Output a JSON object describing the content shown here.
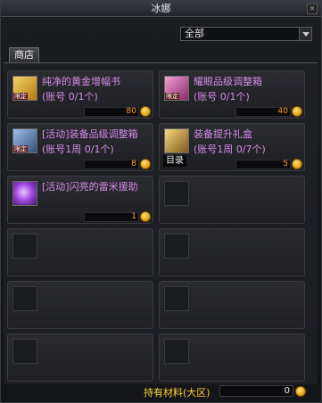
{
  "window": {
    "title": "冰娜"
  },
  "filter": {
    "selected": "全部"
  },
  "tab": {
    "label": "商店"
  },
  "catalog_label": "目录",
  "footer": {
    "label": "持有材料(大区)",
    "value": "0"
  },
  "items": [
    {
      "name": "纯净的黄金增幅书",
      "limit": "(账号 0/1个)",
      "price": "80",
      "badge": "限定",
      "icon": "gold-book-icon",
      "color": "#d9a22a"
    },
    {
      "name": "耀眼品级调整箱",
      "limit": "(账号 0/1个)",
      "price": "40",
      "badge": "限定",
      "icon": "pink-box-icon",
      "color": "#c84f9e"
    },
    {
      "name": "[活动]装备品级调整箱",
      "limit": "(账号1周 0/1个)",
      "price": "8",
      "badge": "限定",
      "icon": "blue-box-icon",
      "color": "#5b7aa8"
    },
    {
      "name": "装备提升礼盒",
      "limit": "(账号1周 0/7个)",
      "price": "5",
      "badge": "",
      "icon": "gift-box-icon",
      "color": "#b9892e"
    },
    {
      "name": "[活动]闪亮的雷米援助",
      "limit": "",
      "price": "1",
      "badge": "",
      "icon": "purple-orb-icon",
      "color": "#8a4ad0"
    }
  ]
}
